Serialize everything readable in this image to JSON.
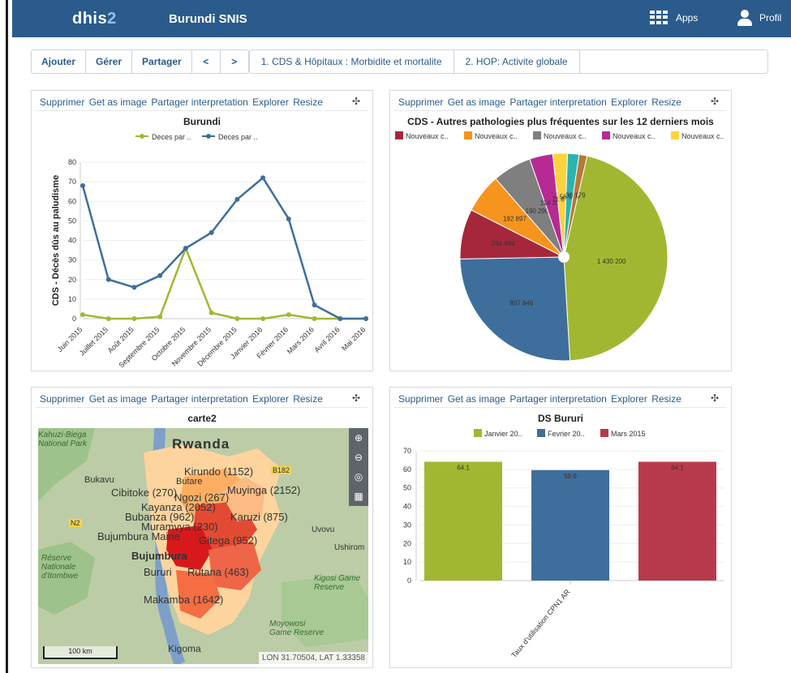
{
  "app": {
    "logo_prefix": "dhis",
    "logo_num": "2",
    "title": "Burundi SNIS",
    "apps_label": "Apps",
    "profile_label": "Profil"
  },
  "toolbar": {
    "add": "Ajouter",
    "manage": "Gérer",
    "share": "Partager",
    "prev": "<",
    "next": ">",
    "tabs": [
      "1. CDS & Hôpitaux : Morbidite et mortalite",
      "2. HOP: Activite globale"
    ]
  },
  "widget_actions": {
    "delete": "Supprimer",
    "get_image": "Get as image",
    "share": "Partager interpretation",
    "explore": "Explorer",
    "resize": "Resize"
  },
  "widgets": {
    "w1": {
      "title": "Burundi"
    },
    "w2": {
      "title": "CDS - Autres pathologies plus fréquentes sur les 12 derniers mois"
    },
    "w3": {
      "title": "carte2"
    },
    "w4": {
      "title": "DS Bururi"
    }
  },
  "map": {
    "labels": [
      "Rwanda",
      "Kirundo (1152)",
      "Butare",
      "Muyinga (2152)",
      "Bukavu",
      "Cibitoke (270)",
      "Ngozi (267)",
      "Kayanza (2052)",
      "Bubanza (962)",
      "Muramvya (230)",
      "Karuzi (875)",
      "Bujumbura Mairie",
      "Gitega (952)",
      "Bujumbura",
      "Bururi",
      "Rutana (463)",
      "Makamba (1642)",
      "Uvovu",
      "Ushirom",
      "Réserve Nationale d'Itombwe",
      "Kahuzi-Biega National Park",
      "Kigosi Game Reserve",
      "Moyowosi Game Reserve",
      "Kigoma",
      "N2",
      "B182"
    ],
    "scale": "100 km",
    "coords": "LON 31.70504, LAT 1.33358",
    "colors": {
      "high": "#d7191c",
      "mid": "#f46d43",
      "low": "#fdae61",
      "lowest": "#fee08b"
    }
  },
  "chart_data": [
    {
      "type": "line",
      "title": "Burundi",
      "ylabel": "CDS - Décès dûs au paludisme",
      "ylim": [
        0,
        80
      ],
      "yticks": [
        0,
        10,
        20,
        30,
        40,
        50,
        60,
        70,
        80
      ],
      "categories": [
        "Juin 2015",
        "Juillet 2015",
        "Août 2015",
        "Septembre 2015",
        "Octobre 2015",
        "Novembre 2015",
        "Décembre 2015",
        "Janvier 2016",
        "Février 2016",
        "Mars 2016",
        "Avril 2016",
        "Mai 2016"
      ],
      "series": [
        {
          "name": "Deces par ..",
          "color": "#a2b731",
          "values": [
            2,
            0,
            0,
            1,
            36,
            3,
            0,
            0,
            2,
            0,
            0,
            0
          ]
        },
        {
          "name": "Deces par ..",
          "color": "#3e6e9b",
          "values": [
            68,
            20,
            16,
            22,
            36,
            44,
            61,
            72,
            51,
            7,
            0,
            0
          ]
        }
      ]
    },
    {
      "type": "pie",
      "title": "CDS - Autres pathologies plus fréquentes sur les 12 derniers mois",
      "legend": [
        "Nouveaux c..",
        "Nouveaux c..",
        "Nouveaux c..",
        "Nouveaux c..",
        "Nouveaux c.."
      ],
      "legend_colors": [
        "#a6273b",
        "#f7941d",
        "#7f7f7f",
        "#b72a93",
        "#fcd23d"
      ],
      "slices": [
        {
          "label": "1 430 200",
          "value": 1430200,
          "color": "#a2b731"
        },
        {
          "label": "807 646",
          "value": 807646,
          "color": "#3e6e9b"
        },
        {
          "label": "244 684",
          "value": 244684,
          "color": "#a6273b"
        },
        {
          "label": "192 897",
          "value": 192897,
          "color": "#f7941d"
        },
        {
          "label": "190 290",
          "value": 190290,
          "color": "#7f7f7f"
        },
        {
          "label": "114 201",
          "value": 114201,
          "color": "#b72a93"
        },
        {
          "label": "71 879",
          "value": 71879,
          "color": "#fcd23d"
        },
        {
          "label": "56 540",
          "value": 56540,
          "color": "#2bb3b1"
        },
        {
          "label": "39 179",
          "value": 39179,
          "color": "#b57a36"
        }
      ]
    },
    {
      "type": "bar",
      "title": "DS Bururi",
      "categories": [
        "Taux d'utilisation CPN1 AR"
      ],
      "ylim": [
        0,
        70
      ],
      "yticks": [
        0,
        10,
        20,
        30,
        40,
        50,
        60,
        70
      ],
      "series": [
        {
          "name": "Janvier 20..",
          "color": "#a2b731",
          "values": [
            64.1
          ]
        },
        {
          "name": "Fevrier 20..",
          "color": "#3e6e9b",
          "values": [
            59.6
          ]
        },
        {
          "name": "Mars 2015",
          "color": "#b73a4a",
          "values": [
            64.1
          ]
        }
      ]
    }
  ]
}
